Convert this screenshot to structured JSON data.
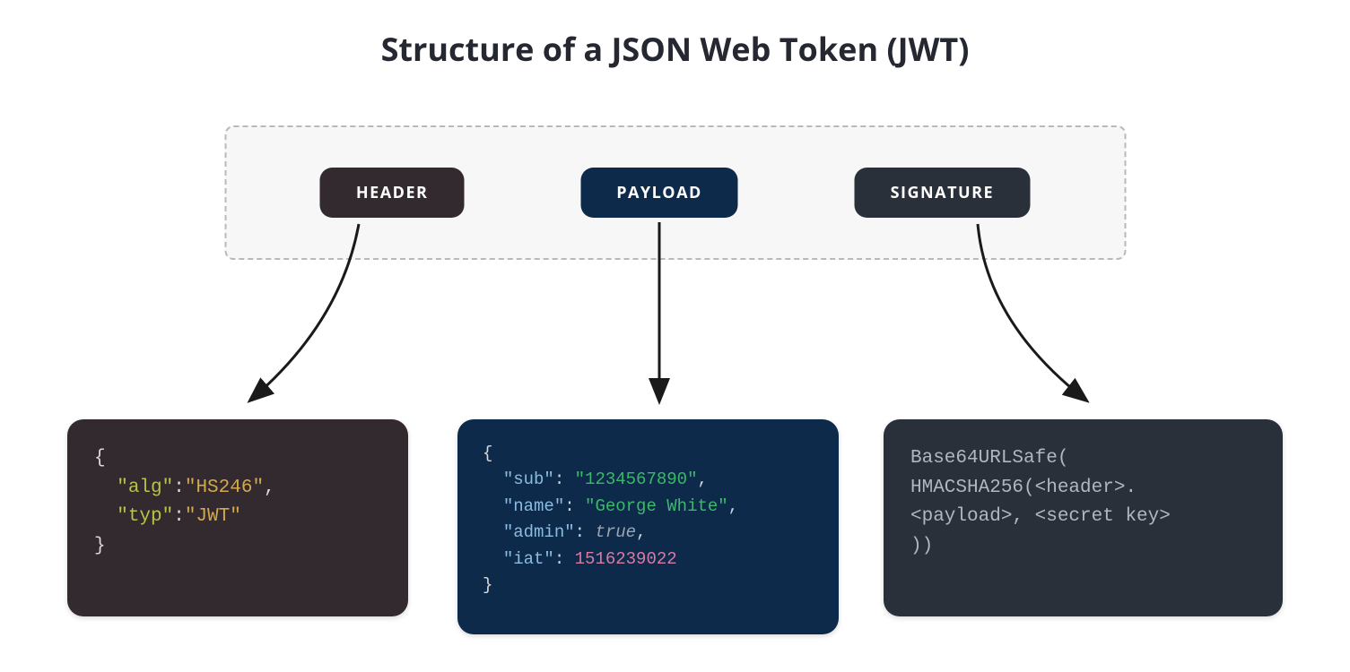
{
  "title": "Structure of a JSON Web Token (JWT)",
  "parts": {
    "header_label": "HEADER",
    "payload_label": "PAYLOAD",
    "signature_label": "SIGNATURE"
  },
  "header_json": {
    "alg": "HS246",
    "typ": "JWT"
  },
  "payload_json": {
    "sub": "1234567890",
    "name": "George White",
    "admin": "true",
    "iat": "1516239022"
  },
  "signature_text": {
    "line1": "Base64URLSafe(",
    "line2": "HMACSHA256(<header>.",
    "line3": "<payload>, <secret key>",
    "line4": "))"
  },
  "colors": {
    "header_bg": "#322a2e",
    "payload_bg": "#0e2a4a",
    "signature_bg": "#2a303a"
  }
}
